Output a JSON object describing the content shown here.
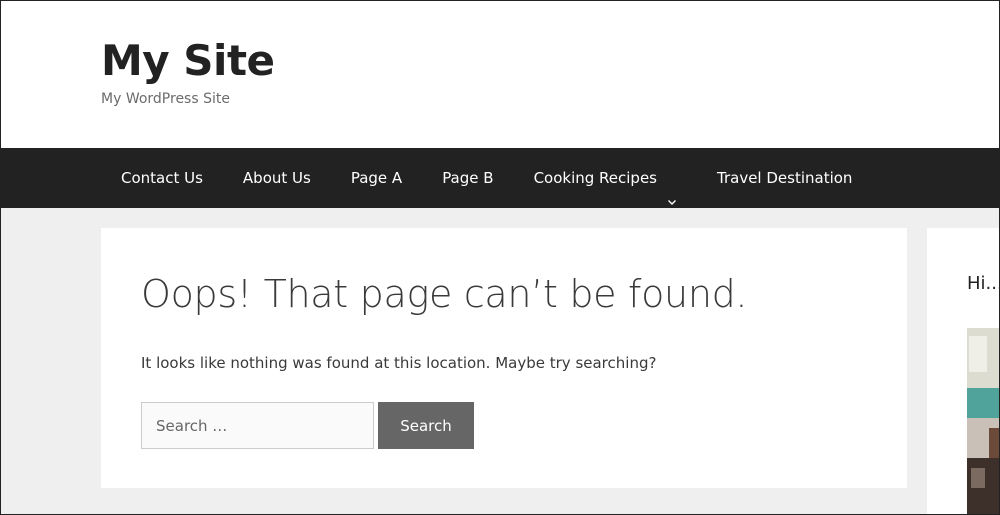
{
  "header": {
    "site_title": "My Site",
    "tagline": "My WordPress Site"
  },
  "nav": {
    "items": [
      {
        "label": "Contact Us",
        "has_dropdown": false
      },
      {
        "label": "About Us",
        "has_dropdown": false
      },
      {
        "label": "Page A",
        "has_dropdown": false
      },
      {
        "label": "Page B",
        "has_dropdown": false
      },
      {
        "label": "Cooking Recipes",
        "has_dropdown": true,
        "icon": "chevron-down-icon"
      },
      {
        "label": "Travel Destination",
        "has_dropdown": false
      }
    ]
  },
  "main": {
    "heading": "Oops! That page can’t be found.",
    "message": "It looks like nothing was found at this location. Maybe try searching?",
    "search": {
      "placeholder": "Search …",
      "value": "",
      "button_label": "Search"
    }
  },
  "sidebar": {
    "heading": "Hi..."
  },
  "colors": {
    "nav_background": "#222222",
    "page_background": "#efefef",
    "card_background": "#ffffff",
    "search_button": "#666666",
    "title_text": "#222222"
  }
}
